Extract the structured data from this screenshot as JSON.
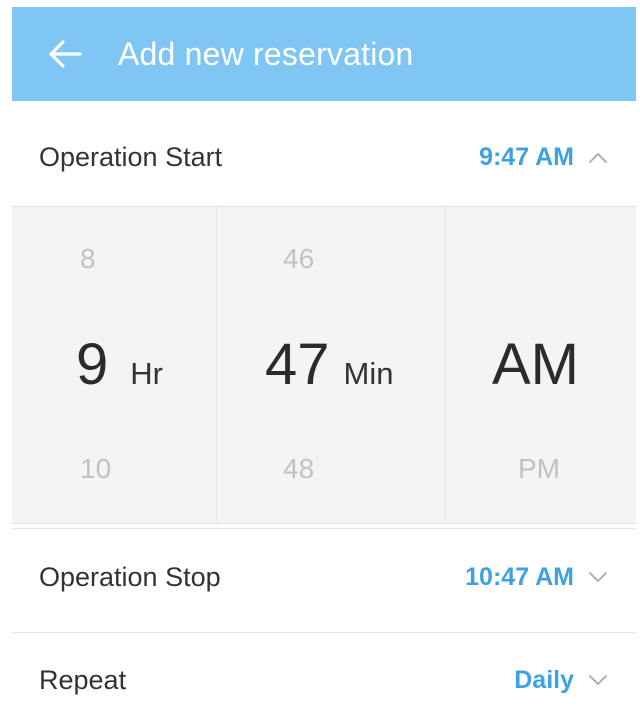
{
  "app_bar": {
    "title": "Add new reservation",
    "back_icon": "arrow-left-icon",
    "color": "#7fc6f4"
  },
  "operation_start": {
    "label": "Operation Start",
    "value": "9:47 AM",
    "chevron_icon": "chevron-up-icon",
    "expanded": true
  },
  "time_picker": {
    "hour": {
      "prev": "8",
      "current": "9",
      "next": "10",
      "unit": "Hr"
    },
    "minute": {
      "prev": "46",
      "current": "47",
      "next": "48",
      "unit": "Min"
    },
    "period": {
      "prev": "",
      "current": "AM",
      "next": "PM"
    }
  },
  "operation_stop": {
    "label": "Operation Stop",
    "value": "10:47 AM",
    "chevron_icon": "chevron-down-icon"
  },
  "repeat": {
    "label": "Repeat",
    "value": "Daily",
    "chevron_icon": "chevron-down-icon"
  },
  "colors": {
    "accent": "#3ea2e2",
    "picker_bg": "#f4f4f4"
  }
}
